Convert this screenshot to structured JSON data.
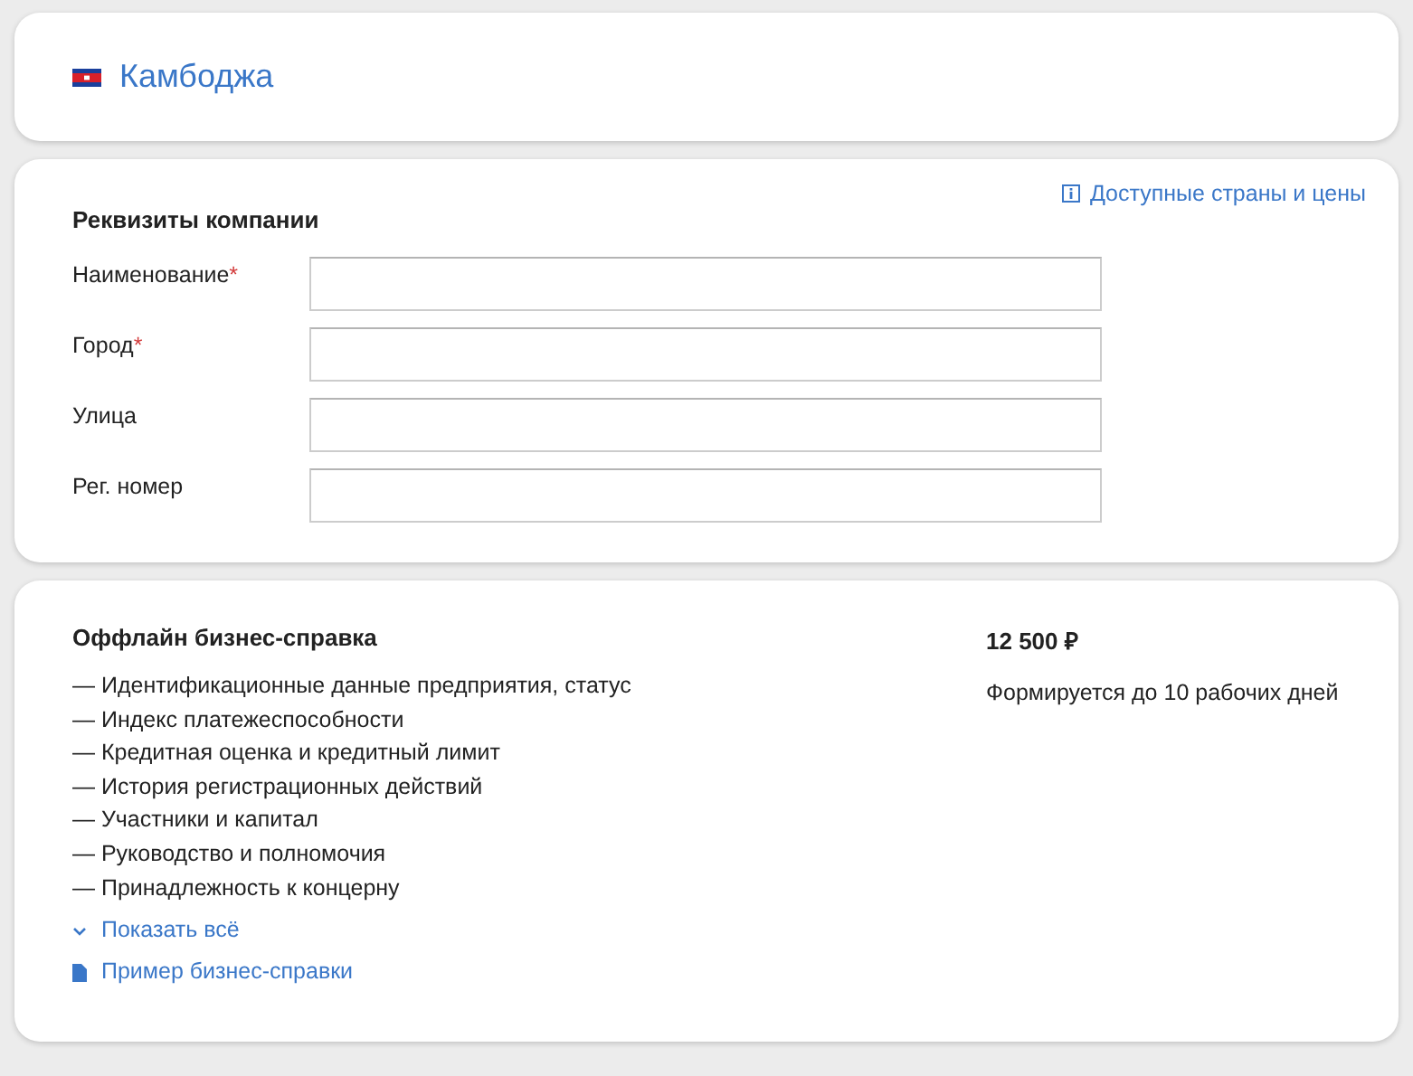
{
  "country": {
    "name": "Камбоджа"
  },
  "company": {
    "title": "Реквизиты компании",
    "info_link": "Доступные страны и цены",
    "fields": [
      {
        "label": "Наименование",
        "required_mark": "*"
      },
      {
        "label": "Город",
        "required_mark": "*"
      },
      {
        "label": "Улица"
      },
      {
        "label": "Рег. номер"
      }
    ]
  },
  "product": {
    "title": "Оффлайн бизнес-справка",
    "price": "12 500 ₽",
    "term": "Формируется до 10 рабочих дней",
    "items": [
      "— Идентификационные данные предприятия, статус",
      "— Индекс платежеспособности",
      "— Кредитная оценка и кредитный лимит",
      "— История регистрационных действий",
      "— Участники и капитал",
      "— Руководство и полномочия",
      "— Принадлежность к концерну"
    ],
    "show_all": "Показать всё",
    "sample_link": "Пример бизнес-справки"
  }
}
